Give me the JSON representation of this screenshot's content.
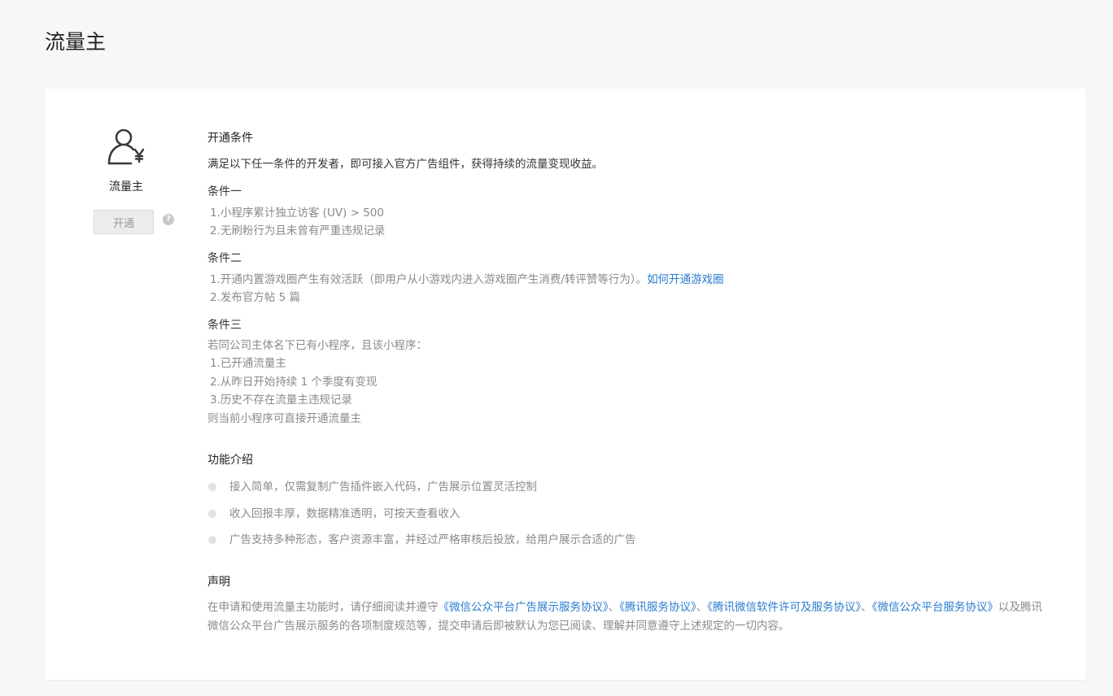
{
  "page": {
    "title": "流量主"
  },
  "product": {
    "name": "流量主",
    "icon": "user-yen-icon",
    "open_button": "开通",
    "help_icon": "question-icon"
  },
  "conditions": {
    "title": "开通条件",
    "intro": "满足以下任一条件的开发者，即可接入官方广告组件，获得持续的流量变现收益。",
    "one": {
      "title": "条件一",
      "items": [
        "1.小程序累计独立访客 (UV) > 500",
        "2.无刷粉行为且未曾有严重违规记录"
      ]
    },
    "two": {
      "title": "条件二",
      "item1": "1.开通内置游戏圈产生有效活跃（即用户从小游戏内进入游戏圈产生消费/转评赞等行为）。",
      "item1_link": "如何开通游戏圈",
      "item2": "2.发布官方帖 5 篇"
    },
    "three": {
      "title": "条件三",
      "lead": "若同公司主体名下已有小程序，且该小程序：",
      "items": [
        "1.已开通流量主",
        "2.从昨日开始持续 1 个季度有变现",
        "3.历史不存在流量主违规记录"
      ],
      "tail": "则当前小程序可直接开通流量主"
    }
  },
  "features": {
    "title": "功能介绍",
    "items": [
      "接入简单，仅需复制广告插件嵌入代码，广告展示位置灵活控制",
      "收入回报丰厚，数据精准透明，可按天查看收入",
      "广告支持多种形态，客户资源丰富，并经过严格审核后投放，给用户展示合适的广告"
    ]
  },
  "statement": {
    "title": "声明",
    "prefix": "在申请和使用流量主功能时，请仔细阅读并遵守",
    "links": [
      "《微信公众平台广告展示服务协议》",
      "《腾讯服务协议》",
      "《腾讯微信软件许可及服务协议》",
      "《微信公众平台服务协议》"
    ],
    "separator": "、",
    "suffix": "以及腾讯微信公众平台广告展示服务的各项制度规范等，提交申请后即被默认为您已阅读、理解并同意遵守上述规定的一切内容。"
  },
  "colors": {
    "link": "#2a7ccf",
    "background": "#f6f7f9",
    "muted_text": "#8a8a8a"
  }
}
